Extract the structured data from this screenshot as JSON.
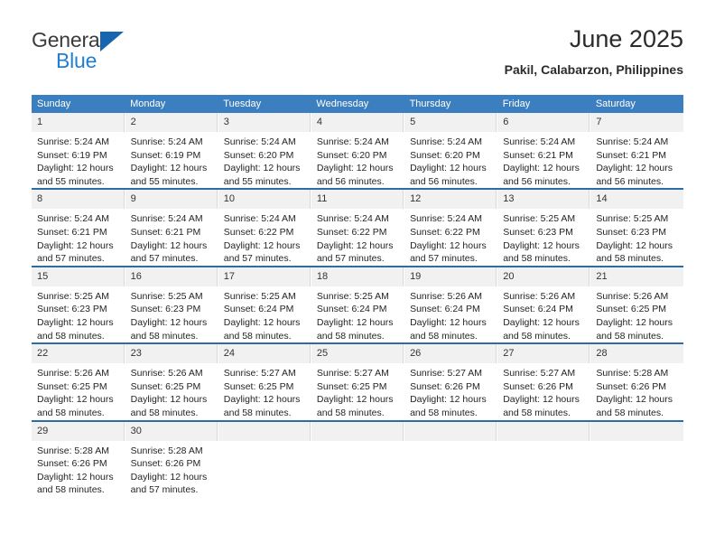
{
  "brand": {
    "name_top": "General",
    "name_bottom": "Blue",
    "accent_color": "#1f7fd4",
    "triangle_color": "#1565b0"
  },
  "header": {
    "title": "June 2025",
    "subtitle": "Pakil, Calabarzon, Philippines"
  },
  "theme": {
    "header_bg": "#3c7fc1",
    "row_divider": "#2e6da4",
    "daynum_bg": "#f1f1f1",
    "text": "#242424"
  },
  "weekday_headers": [
    "Sunday",
    "Monday",
    "Tuesday",
    "Wednesday",
    "Thursday",
    "Friday",
    "Saturday"
  ],
  "weeks": [
    [
      {
        "day": "1",
        "sunrise": "Sunrise: 5:24 AM",
        "sunset": "Sunset: 6:19 PM",
        "daylight1": "Daylight: 12 hours",
        "daylight2": "and 55 minutes."
      },
      {
        "day": "2",
        "sunrise": "Sunrise: 5:24 AM",
        "sunset": "Sunset: 6:19 PM",
        "daylight1": "Daylight: 12 hours",
        "daylight2": "and 55 minutes."
      },
      {
        "day": "3",
        "sunrise": "Sunrise: 5:24 AM",
        "sunset": "Sunset: 6:20 PM",
        "daylight1": "Daylight: 12 hours",
        "daylight2": "and 55 minutes."
      },
      {
        "day": "4",
        "sunrise": "Sunrise: 5:24 AM",
        "sunset": "Sunset: 6:20 PM",
        "daylight1": "Daylight: 12 hours",
        "daylight2": "and 56 minutes."
      },
      {
        "day": "5",
        "sunrise": "Sunrise: 5:24 AM",
        "sunset": "Sunset: 6:20 PM",
        "daylight1": "Daylight: 12 hours",
        "daylight2": "and 56 minutes."
      },
      {
        "day": "6",
        "sunrise": "Sunrise: 5:24 AM",
        "sunset": "Sunset: 6:21 PM",
        "daylight1": "Daylight: 12 hours",
        "daylight2": "and 56 minutes."
      },
      {
        "day": "7",
        "sunrise": "Sunrise: 5:24 AM",
        "sunset": "Sunset: 6:21 PM",
        "daylight1": "Daylight: 12 hours",
        "daylight2": "and 56 minutes."
      }
    ],
    [
      {
        "day": "8",
        "sunrise": "Sunrise: 5:24 AM",
        "sunset": "Sunset: 6:21 PM",
        "daylight1": "Daylight: 12 hours",
        "daylight2": "and 57 minutes."
      },
      {
        "day": "9",
        "sunrise": "Sunrise: 5:24 AM",
        "sunset": "Sunset: 6:21 PM",
        "daylight1": "Daylight: 12 hours",
        "daylight2": "and 57 minutes."
      },
      {
        "day": "10",
        "sunrise": "Sunrise: 5:24 AM",
        "sunset": "Sunset: 6:22 PM",
        "daylight1": "Daylight: 12 hours",
        "daylight2": "and 57 minutes."
      },
      {
        "day": "11",
        "sunrise": "Sunrise: 5:24 AM",
        "sunset": "Sunset: 6:22 PM",
        "daylight1": "Daylight: 12 hours",
        "daylight2": "and 57 minutes."
      },
      {
        "day": "12",
        "sunrise": "Sunrise: 5:24 AM",
        "sunset": "Sunset: 6:22 PM",
        "daylight1": "Daylight: 12 hours",
        "daylight2": "and 57 minutes."
      },
      {
        "day": "13",
        "sunrise": "Sunrise: 5:25 AM",
        "sunset": "Sunset: 6:23 PM",
        "daylight1": "Daylight: 12 hours",
        "daylight2": "and 58 minutes."
      },
      {
        "day": "14",
        "sunrise": "Sunrise: 5:25 AM",
        "sunset": "Sunset: 6:23 PM",
        "daylight1": "Daylight: 12 hours",
        "daylight2": "and 58 minutes."
      }
    ],
    [
      {
        "day": "15",
        "sunrise": "Sunrise: 5:25 AM",
        "sunset": "Sunset: 6:23 PM",
        "daylight1": "Daylight: 12 hours",
        "daylight2": "and 58 minutes."
      },
      {
        "day": "16",
        "sunrise": "Sunrise: 5:25 AM",
        "sunset": "Sunset: 6:23 PM",
        "daylight1": "Daylight: 12 hours",
        "daylight2": "and 58 minutes."
      },
      {
        "day": "17",
        "sunrise": "Sunrise: 5:25 AM",
        "sunset": "Sunset: 6:24 PM",
        "daylight1": "Daylight: 12 hours",
        "daylight2": "and 58 minutes."
      },
      {
        "day": "18",
        "sunrise": "Sunrise: 5:25 AM",
        "sunset": "Sunset: 6:24 PM",
        "daylight1": "Daylight: 12 hours",
        "daylight2": "and 58 minutes."
      },
      {
        "day": "19",
        "sunrise": "Sunrise: 5:26 AM",
        "sunset": "Sunset: 6:24 PM",
        "daylight1": "Daylight: 12 hours",
        "daylight2": "and 58 minutes."
      },
      {
        "day": "20",
        "sunrise": "Sunrise: 5:26 AM",
        "sunset": "Sunset: 6:24 PM",
        "daylight1": "Daylight: 12 hours",
        "daylight2": "and 58 minutes."
      },
      {
        "day": "21",
        "sunrise": "Sunrise: 5:26 AM",
        "sunset": "Sunset: 6:25 PM",
        "daylight1": "Daylight: 12 hours",
        "daylight2": "and 58 minutes."
      }
    ],
    [
      {
        "day": "22",
        "sunrise": "Sunrise: 5:26 AM",
        "sunset": "Sunset: 6:25 PM",
        "daylight1": "Daylight: 12 hours",
        "daylight2": "and 58 minutes."
      },
      {
        "day": "23",
        "sunrise": "Sunrise: 5:26 AM",
        "sunset": "Sunset: 6:25 PM",
        "daylight1": "Daylight: 12 hours",
        "daylight2": "and 58 minutes."
      },
      {
        "day": "24",
        "sunrise": "Sunrise: 5:27 AM",
        "sunset": "Sunset: 6:25 PM",
        "daylight1": "Daylight: 12 hours",
        "daylight2": "and 58 minutes."
      },
      {
        "day": "25",
        "sunrise": "Sunrise: 5:27 AM",
        "sunset": "Sunset: 6:25 PM",
        "daylight1": "Daylight: 12 hours",
        "daylight2": "and 58 minutes."
      },
      {
        "day": "26",
        "sunrise": "Sunrise: 5:27 AM",
        "sunset": "Sunset: 6:26 PM",
        "daylight1": "Daylight: 12 hours",
        "daylight2": "and 58 minutes."
      },
      {
        "day": "27",
        "sunrise": "Sunrise: 5:27 AM",
        "sunset": "Sunset: 6:26 PM",
        "daylight1": "Daylight: 12 hours",
        "daylight2": "and 58 minutes."
      },
      {
        "day": "28",
        "sunrise": "Sunrise: 5:28 AM",
        "sunset": "Sunset: 6:26 PM",
        "daylight1": "Daylight: 12 hours",
        "daylight2": "and 58 minutes."
      }
    ],
    [
      {
        "day": "29",
        "sunrise": "Sunrise: 5:28 AM",
        "sunset": "Sunset: 6:26 PM",
        "daylight1": "Daylight: 12 hours",
        "daylight2": "and 58 minutes."
      },
      {
        "day": "30",
        "sunrise": "Sunrise: 5:28 AM",
        "sunset": "Sunset: 6:26 PM",
        "daylight1": "Daylight: 12 hours",
        "daylight2": "and 57 minutes."
      },
      {
        "day": "",
        "sunrise": "",
        "sunset": "",
        "daylight1": "",
        "daylight2": ""
      },
      {
        "day": "",
        "sunrise": "",
        "sunset": "",
        "daylight1": "",
        "daylight2": ""
      },
      {
        "day": "",
        "sunrise": "",
        "sunset": "",
        "daylight1": "",
        "daylight2": ""
      },
      {
        "day": "",
        "sunrise": "",
        "sunset": "",
        "daylight1": "",
        "daylight2": ""
      },
      {
        "day": "",
        "sunrise": "",
        "sunset": "",
        "daylight1": "",
        "daylight2": ""
      }
    ]
  ]
}
